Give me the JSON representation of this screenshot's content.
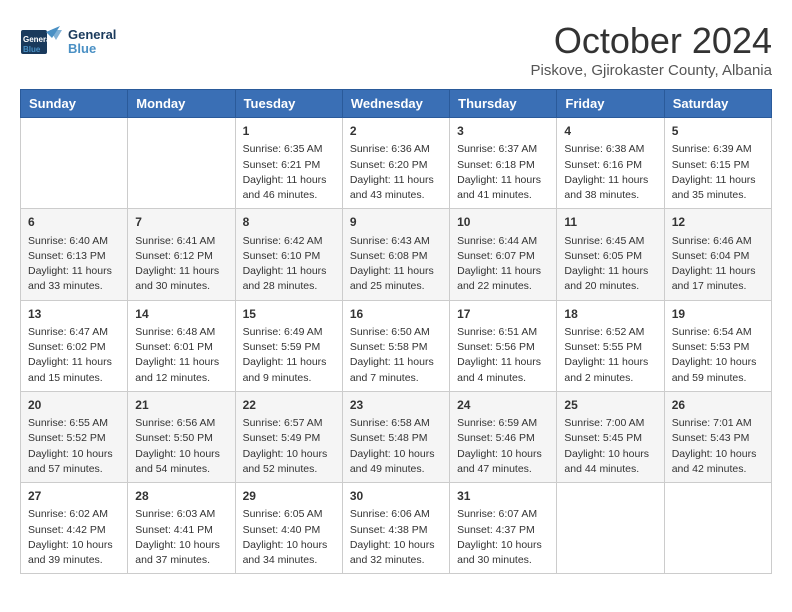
{
  "header": {
    "logo_line1": "General",
    "logo_line2": "Blue",
    "month": "October 2024",
    "location": "Piskove, Gjirokaster County, Albania"
  },
  "days_of_week": [
    "Sunday",
    "Monday",
    "Tuesday",
    "Wednesday",
    "Thursday",
    "Friday",
    "Saturday"
  ],
  "weeks": [
    [
      {
        "day": "",
        "info": ""
      },
      {
        "day": "",
        "info": ""
      },
      {
        "day": "1",
        "info": "Sunrise: 6:35 AM\nSunset: 6:21 PM\nDaylight: 11 hours and 46 minutes."
      },
      {
        "day": "2",
        "info": "Sunrise: 6:36 AM\nSunset: 6:20 PM\nDaylight: 11 hours and 43 minutes."
      },
      {
        "day": "3",
        "info": "Sunrise: 6:37 AM\nSunset: 6:18 PM\nDaylight: 11 hours and 41 minutes."
      },
      {
        "day": "4",
        "info": "Sunrise: 6:38 AM\nSunset: 6:16 PM\nDaylight: 11 hours and 38 minutes."
      },
      {
        "day": "5",
        "info": "Sunrise: 6:39 AM\nSunset: 6:15 PM\nDaylight: 11 hours and 35 minutes."
      }
    ],
    [
      {
        "day": "6",
        "info": "Sunrise: 6:40 AM\nSunset: 6:13 PM\nDaylight: 11 hours and 33 minutes."
      },
      {
        "day": "7",
        "info": "Sunrise: 6:41 AM\nSunset: 6:12 PM\nDaylight: 11 hours and 30 minutes."
      },
      {
        "day": "8",
        "info": "Sunrise: 6:42 AM\nSunset: 6:10 PM\nDaylight: 11 hours and 28 minutes."
      },
      {
        "day": "9",
        "info": "Sunrise: 6:43 AM\nSunset: 6:08 PM\nDaylight: 11 hours and 25 minutes."
      },
      {
        "day": "10",
        "info": "Sunrise: 6:44 AM\nSunset: 6:07 PM\nDaylight: 11 hours and 22 minutes."
      },
      {
        "day": "11",
        "info": "Sunrise: 6:45 AM\nSunset: 6:05 PM\nDaylight: 11 hours and 20 minutes."
      },
      {
        "day": "12",
        "info": "Sunrise: 6:46 AM\nSunset: 6:04 PM\nDaylight: 11 hours and 17 minutes."
      }
    ],
    [
      {
        "day": "13",
        "info": "Sunrise: 6:47 AM\nSunset: 6:02 PM\nDaylight: 11 hours and 15 minutes."
      },
      {
        "day": "14",
        "info": "Sunrise: 6:48 AM\nSunset: 6:01 PM\nDaylight: 11 hours and 12 minutes."
      },
      {
        "day": "15",
        "info": "Sunrise: 6:49 AM\nSunset: 5:59 PM\nDaylight: 11 hours and 9 minutes."
      },
      {
        "day": "16",
        "info": "Sunrise: 6:50 AM\nSunset: 5:58 PM\nDaylight: 11 hours and 7 minutes."
      },
      {
        "day": "17",
        "info": "Sunrise: 6:51 AM\nSunset: 5:56 PM\nDaylight: 11 hours and 4 minutes."
      },
      {
        "day": "18",
        "info": "Sunrise: 6:52 AM\nSunset: 5:55 PM\nDaylight: 11 hours and 2 minutes."
      },
      {
        "day": "19",
        "info": "Sunrise: 6:54 AM\nSunset: 5:53 PM\nDaylight: 10 hours and 59 minutes."
      }
    ],
    [
      {
        "day": "20",
        "info": "Sunrise: 6:55 AM\nSunset: 5:52 PM\nDaylight: 10 hours and 57 minutes."
      },
      {
        "day": "21",
        "info": "Sunrise: 6:56 AM\nSunset: 5:50 PM\nDaylight: 10 hours and 54 minutes."
      },
      {
        "day": "22",
        "info": "Sunrise: 6:57 AM\nSunset: 5:49 PM\nDaylight: 10 hours and 52 minutes."
      },
      {
        "day": "23",
        "info": "Sunrise: 6:58 AM\nSunset: 5:48 PM\nDaylight: 10 hours and 49 minutes."
      },
      {
        "day": "24",
        "info": "Sunrise: 6:59 AM\nSunset: 5:46 PM\nDaylight: 10 hours and 47 minutes."
      },
      {
        "day": "25",
        "info": "Sunrise: 7:00 AM\nSunset: 5:45 PM\nDaylight: 10 hours and 44 minutes."
      },
      {
        "day": "26",
        "info": "Sunrise: 7:01 AM\nSunset: 5:43 PM\nDaylight: 10 hours and 42 minutes."
      }
    ],
    [
      {
        "day": "27",
        "info": "Sunrise: 6:02 AM\nSunset: 4:42 PM\nDaylight: 10 hours and 39 minutes."
      },
      {
        "day": "28",
        "info": "Sunrise: 6:03 AM\nSunset: 4:41 PM\nDaylight: 10 hours and 37 minutes."
      },
      {
        "day": "29",
        "info": "Sunrise: 6:05 AM\nSunset: 4:40 PM\nDaylight: 10 hours and 34 minutes."
      },
      {
        "day": "30",
        "info": "Sunrise: 6:06 AM\nSunset: 4:38 PM\nDaylight: 10 hours and 32 minutes."
      },
      {
        "day": "31",
        "info": "Sunrise: 6:07 AM\nSunset: 4:37 PM\nDaylight: 10 hours and 30 minutes."
      },
      {
        "day": "",
        "info": ""
      },
      {
        "day": "",
        "info": ""
      }
    ]
  ]
}
